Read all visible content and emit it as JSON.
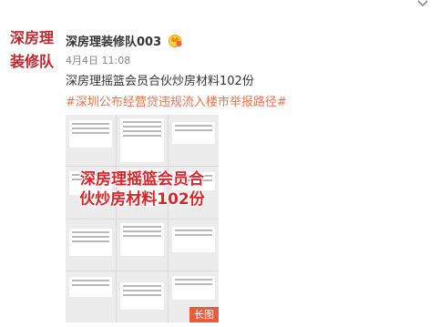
{
  "avatar": {
    "line1": "深房理",
    "line2": "装修队"
  },
  "post": {
    "author": "深房理装修队003",
    "badge_icon": "verified-crown-icon",
    "time": "4月4日 11:08",
    "text": "深房理摇篮会员合伙炒房材料102份",
    "hashtag": "#深圳公布经营贷违规流入楼市举报路径#"
  },
  "image": {
    "overlay_line1": "深房理摇篮会员合",
    "overlay_line2": "伙炒房材料102份",
    "badge": "长图"
  },
  "colors": {
    "brand_red": "#c0262d",
    "hashtag": "#eb7350",
    "badge_bg": "#e85c3a",
    "overlay_red": "#d9262b"
  }
}
